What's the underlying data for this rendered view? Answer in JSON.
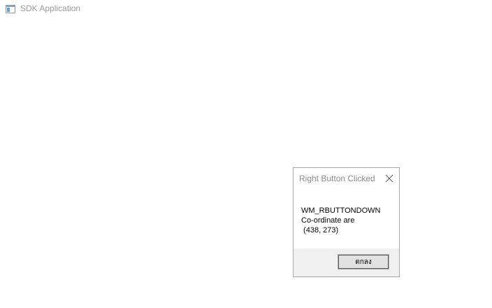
{
  "window": {
    "title": "SDK Application",
    "icon": "app-window-icon"
  },
  "dialog": {
    "title": "Right Button Clicked",
    "close_icon": "close-icon",
    "message_lines": [
      "WM_RBUTTONDOWN",
      "Co-ordinate are",
      " (438, 273)"
    ],
    "ok_label": "ตกลง"
  }
}
